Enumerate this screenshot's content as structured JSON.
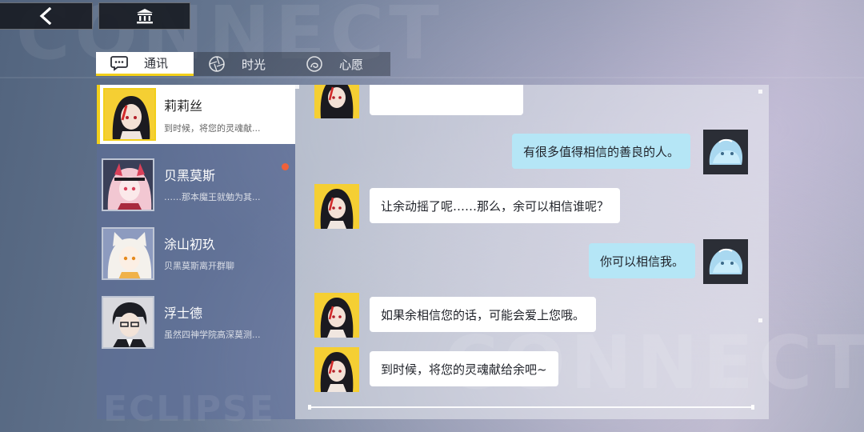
{
  "background": {
    "watermark_top": "CONNECT",
    "watermark_bottom": "CONNECT",
    "watermark_list": "ECLIPSE"
  },
  "nav": {
    "back_icon": "chevron-left-icon",
    "home_icon": "bank-icon"
  },
  "tabs": [
    {
      "label": "通讯",
      "icon": "chat-bubble-icon",
      "active": true
    },
    {
      "label": "时光",
      "icon": "aperture-icon",
      "active": false
    },
    {
      "label": "心愿",
      "icon": "wish-icon",
      "active": false
    }
  ],
  "contacts": [
    {
      "name": "莉莉丝",
      "preview": "到时候，将您的灵魂献...",
      "active": true,
      "unread": false
    },
    {
      "name": "贝黑莫斯",
      "preview": "……那本魔王就勉为其...",
      "active": false,
      "unread": true
    },
    {
      "name": "涂山初玖",
      "preview": "贝黑莫斯离开群聊",
      "active": false,
      "unread": false
    },
    {
      "name": "浮士德",
      "preview": "虽然四神学院高深莫测...",
      "active": false,
      "unread": false
    }
  ],
  "messages": [
    {
      "side": "left",
      "text": ""
    },
    {
      "side": "right",
      "text": "有很多值得相信的善良的人。"
    },
    {
      "side": "left",
      "text": "让余动摇了呢……那么，余可以相信谁呢？"
    },
    {
      "side": "right",
      "text": "你可以相信我。"
    },
    {
      "side": "left",
      "text": "如果余相信您的话，可能会爱上您哦。"
    },
    {
      "side": "left",
      "text": "到时候，将您的灵魂献给余吧~"
    }
  ],
  "colors": {
    "accent": "#f2cf1a",
    "user_bubble": "#b5e6f6",
    "unread_dot": "#f0613a"
  }
}
